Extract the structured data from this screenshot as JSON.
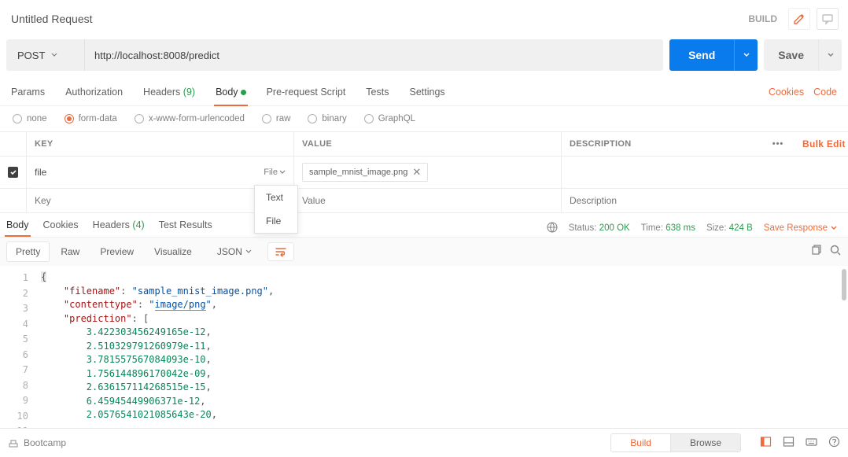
{
  "header": {
    "title": "Untitled Request",
    "build": "BUILD"
  },
  "request": {
    "method": "POST",
    "url": "http://localhost:8008/predict",
    "send": "Send",
    "save": "Save"
  },
  "tabs": {
    "items": [
      "Params",
      "Authorization",
      "Headers",
      "Body",
      "Pre-request Script",
      "Tests",
      "Settings"
    ],
    "headers_count": "(9)",
    "right": {
      "cookies": "Cookies",
      "code": "Code"
    }
  },
  "body_types": [
    "none",
    "form-data",
    "x-www-form-urlencoded",
    "raw",
    "binary",
    "GraphQL"
  ],
  "kv": {
    "headers": {
      "key": "KEY",
      "value": "VALUE",
      "desc": "DESCRIPTION",
      "bulk": "Bulk Edit"
    },
    "row1": {
      "key": "file",
      "type": "File",
      "file": "sample_mnist_image.png"
    },
    "placeholders": {
      "key": "Key",
      "value": "Value",
      "desc": "Description"
    },
    "dropdown": {
      "text": "Text",
      "file": "File"
    }
  },
  "response": {
    "tabs": [
      "Body",
      "Cookies",
      "Headers",
      "Test Results"
    ],
    "headers_count": "(4)",
    "status_label": "Status:",
    "status_value": "200 OK",
    "time_label": "Time:",
    "time_value": "638 ms",
    "size_label": "Size:",
    "size_value": "424 B",
    "save": "Save Response"
  },
  "resp_toolbar": {
    "pretty": "Pretty",
    "raw": "Raw",
    "preview": "Preview",
    "visualize": "Visualize",
    "format": "JSON"
  },
  "code_lines": [
    "{",
    "    \"filename\": \"sample_mnist_image.png\",",
    "    \"contenttype\": \"image/png\",",
    "    \"prediction\": [",
    "        3.422303456249165e-12,",
    "        2.510329791260979e-11,",
    "        3.781557567084093e-10,",
    "        1.756144896170042e-09,",
    "        2.636157114268515e-15,",
    "        6.45945449906371e-12,",
    "        2.0576541021085643e-20,"
  ],
  "footer": {
    "bootcamp": "Bootcamp",
    "build": "Build",
    "browse": "Browse"
  }
}
